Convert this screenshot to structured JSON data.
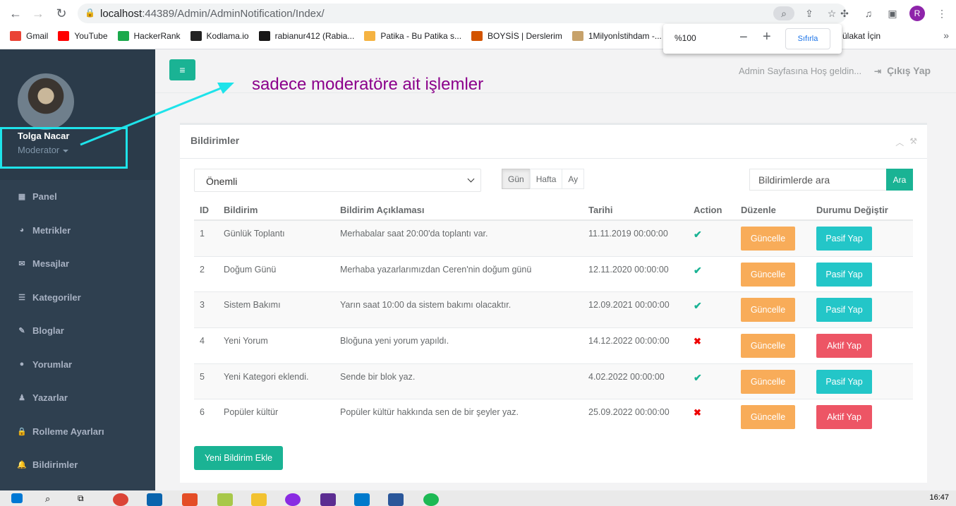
{
  "browser": {
    "url_host": "localhost",
    "url_port_path": ":44389/Admin/AdminNotification/Index/",
    "profile_initial": "R",
    "bookmarks": [
      {
        "label": "Gmail",
        "color": "#ea4335"
      },
      {
        "label": "YouTube",
        "color": "#ff0000"
      },
      {
        "label": "HackerRank",
        "color": "#1ba94c"
      },
      {
        "label": "Kodlama.io",
        "color": "#222222"
      },
      {
        "label": "rabianur412 (Rabia...",
        "color": "#181717"
      },
      {
        "label": "Patika - Bu Patika s...",
        "color": "#f5b342"
      },
      {
        "label": "BOYSİS | Derslerim",
        "color": "#d35400"
      },
      {
        "label": "1Milyonİstihdam -...",
        "color": "#c7a26b"
      }
    ],
    "bookmark_partial": "ülakat İçin",
    "zoom": {
      "value": "%100",
      "minus": "−",
      "plus": "+",
      "reset_label": "Sıfırla"
    }
  },
  "sidebar": {
    "profile_name": "Tolga Nacar",
    "profile_role": "Moderator",
    "items": [
      {
        "label": "Panel",
        "icon": "th-large-icon",
        "glyph": "▦"
      },
      {
        "label": "Metrikler",
        "icon": "pie-chart-icon",
        "glyph": "◕"
      },
      {
        "label": "Mesajlar",
        "icon": "envelope-icon",
        "glyph": "✉"
      },
      {
        "label": "Kategoriler",
        "icon": "list-icon",
        "glyph": "☰"
      },
      {
        "label": "Bloglar",
        "icon": "edit-icon",
        "glyph": "✎"
      },
      {
        "label": "Yorumlar",
        "icon": "comment-icon",
        "glyph": "●"
      },
      {
        "label": "Yazarlar",
        "icon": "user-icon",
        "glyph": "♟"
      },
      {
        "label": "Rolleme Ayarları",
        "icon": "lock-icon",
        "glyph": "🔒"
      },
      {
        "label": "Bildirimler",
        "icon": "bell-icon",
        "glyph": "🔔"
      }
    ]
  },
  "header": {
    "menu_glyph": "≡",
    "welcome": "Admin Sayfasına Hoş geldin...",
    "logout_label": "Çıkış Yap",
    "annotation": "sadece moderatöre ait işlemler"
  },
  "panel": {
    "title": "Bildirimler",
    "filter_selected": "Önemli",
    "period_tabs": [
      "Gün",
      "Hafta",
      "Ay"
    ],
    "search_placeholder": "Bildirimlerde ara",
    "search_button": "Ara",
    "columns": [
      "ID",
      "Bildirim",
      "Bildirim Açıklaması",
      "Tarihi",
      "Action",
      "Düzenle",
      "Durumu Değiştir"
    ],
    "rows": [
      {
        "id": "1",
        "title": "Günlük Toplantı",
        "desc": "Merhabalar saat 20:00'da toplantı var.",
        "date": "11.11.2019 00:00:00",
        "active": true,
        "edit": "Güncelle",
        "toggle": "Pasif Yap"
      },
      {
        "id": "2",
        "title": "Doğum Günü",
        "desc": "Merhaba yazarlarımızdan Ceren'nin doğum günü",
        "date": "12.11.2020 00:00:00",
        "active": true,
        "edit": "Güncelle",
        "toggle": "Pasif Yap"
      },
      {
        "id": "3",
        "title": "Sistem Bakımı",
        "desc": "Yarın saat 10:00 da sistem bakımı olacaktır.",
        "date": "12.09.2021 00:00:00",
        "active": true,
        "edit": "Güncelle",
        "toggle": "Pasif Yap"
      },
      {
        "id": "4",
        "title": "Yeni Yorum",
        "desc": "Bloğuna yeni yorum yapıldı.",
        "date": "14.12.2022 00:00:00",
        "active": false,
        "edit": "Güncelle",
        "toggle": "Aktif Yap"
      },
      {
        "id": "5",
        "title": "Yeni Kategori eklendi.",
        "desc": "Sende bir blok yaz.",
        "date": "4.02.2022 00:00:00",
        "active": true,
        "edit": "Güncelle",
        "toggle": "Pasif Yap"
      },
      {
        "id": "6",
        "title": "Popüler kültür",
        "desc": "Popüler kültür hakkında sen de bir şeyler yaz.",
        "date": "25.09.2022 00:00:00",
        "active": false,
        "edit": "Güncelle",
        "toggle": "Aktif Yap"
      }
    ],
    "add_button": "Yeni Bildirim Ekle"
  },
  "taskbar": {
    "time": "16:47"
  },
  "colors": {
    "accent": "#1ab394",
    "warning": "#f8ac59",
    "info": "#23c6c8",
    "danger": "#ed5565",
    "sidebar": "#2f4050",
    "annotation": "#8b008b",
    "highlight": "#1ee3ea"
  }
}
